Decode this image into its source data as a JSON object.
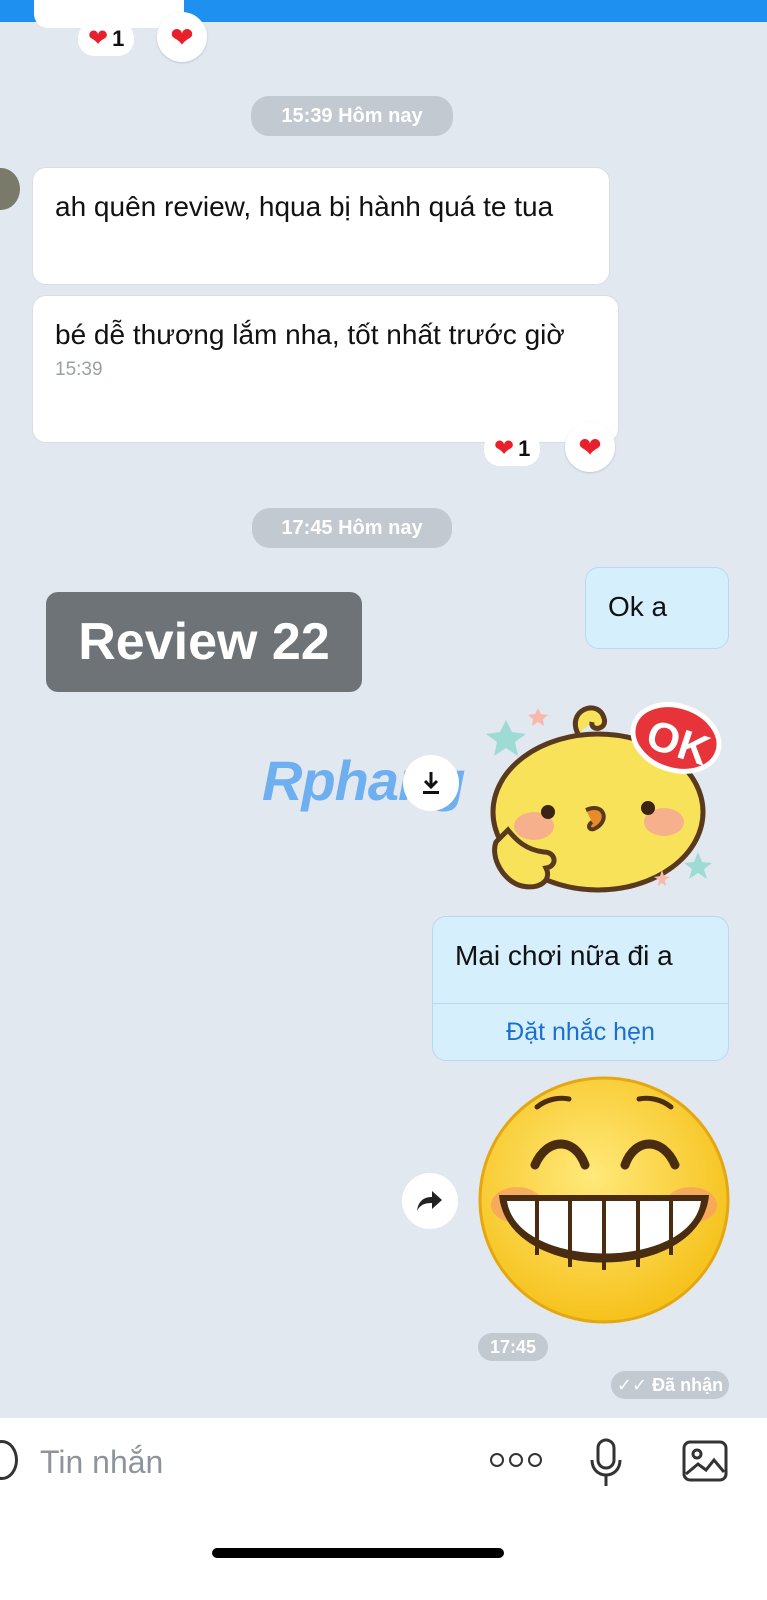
{
  "top": {
    "reaction_count": "1"
  },
  "separators": [
    {
      "label": "15:39 Hôm nay"
    },
    {
      "label": "17:45 Hôm nay"
    }
  ],
  "incoming": {
    "msg1": "ah quên review, hqua bị hành quá te tua",
    "msg2": "bé dễ thương lắm nha, tốt nhất trước giờ",
    "msg2_time": "15:39",
    "reaction_count": "1"
  },
  "overlay": {
    "review_label": "Review 22",
    "watermark": "Rphang"
  },
  "outgoing": {
    "msg_ok": "Ok a",
    "msg_mai": "Mai chơi nữa đi a",
    "reminder_link": "Đặt nhắc hẹn",
    "sticker_time": "17:45",
    "status": "Đã nhận"
  },
  "composer": {
    "placeholder": "Tin nhắn"
  },
  "icons": {
    "heart": "heart-icon",
    "download": "download-icon",
    "forward": "forward-icon",
    "more": "more-icon",
    "mic": "mic-icon",
    "gallery": "image-icon",
    "emoji": "emoji-icon"
  },
  "colors": {
    "bg": "#e2e8f0",
    "incoming_bubble": "#ffffff",
    "outgoing_bubble": "#d6effd",
    "link": "#1a6fcf",
    "heart": "#e8202c"
  }
}
